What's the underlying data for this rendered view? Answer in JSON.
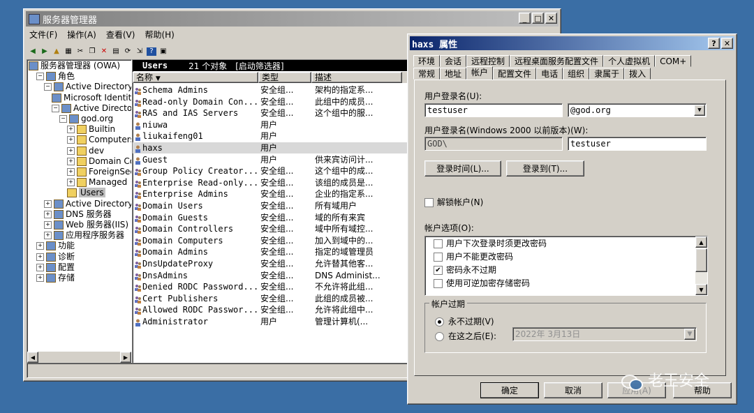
{
  "main": {
    "title": "服务器管理器",
    "menu": [
      "文件(F)",
      "操作(A)",
      "查看(V)",
      "帮助(H)"
    ],
    "tree": [
      {
        "label": "服务器管理器 (OWA)",
        "indent": 0,
        "exp": ""
      },
      {
        "label": "角色",
        "indent": 1,
        "exp": "⊟"
      },
      {
        "label": "Active Directory",
        "indent": 2,
        "exp": "⊟"
      },
      {
        "label": "Microsoft Identity",
        "indent": 3,
        "exp": ""
      },
      {
        "label": "Active Directory",
        "indent": 3,
        "exp": "⊟"
      },
      {
        "label": "god.org",
        "indent": 4,
        "exp": "⊟"
      },
      {
        "label": "Builtin",
        "indent": 5,
        "exp": "⊞"
      },
      {
        "label": "Computers",
        "indent": 5,
        "exp": "⊞"
      },
      {
        "label": "dev",
        "indent": 5,
        "exp": "⊞"
      },
      {
        "label": "Domain Controllers",
        "indent": 5,
        "exp": "⊞"
      },
      {
        "label": "ForeignSecurity",
        "indent": 5,
        "exp": "⊞"
      },
      {
        "label": "Managed",
        "indent": 5,
        "exp": "⊞"
      },
      {
        "label": "Users",
        "indent": 5,
        "exp": "",
        "selected": true
      },
      {
        "label": "Active Directory",
        "indent": 2,
        "exp": "⊞"
      },
      {
        "label": "DNS 服务器",
        "indent": 2,
        "exp": "⊞"
      },
      {
        "label": "Web 服务器(IIS)",
        "indent": 2,
        "exp": "⊞"
      },
      {
        "label": "应用程序服务器",
        "indent": 2,
        "exp": "⊞"
      },
      {
        "label": "功能",
        "indent": 1,
        "exp": "⊞"
      },
      {
        "label": "诊断",
        "indent": 1,
        "exp": "⊞"
      },
      {
        "label": "配置",
        "indent": 1,
        "exp": "⊞"
      },
      {
        "label": "存储",
        "indent": 1,
        "exp": "⊞"
      }
    ],
    "content_header": {
      "title": "Users",
      "count": "21 个对象",
      "filter": "[启动筛选器]"
    },
    "columns": [
      "名称",
      "类型",
      "描述"
    ],
    "rows": [
      {
        "name": "Schema Admins",
        "type": "安全组...",
        "desc": "架构的指定系...",
        "kind": "group"
      },
      {
        "name": "Read-only Domain Con...",
        "type": "安全组...",
        "desc": "此组中的成员...",
        "kind": "group"
      },
      {
        "name": "RAS and IAS Servers",
        "type": "安全组...",
        "desc": "这个组中的服...",
        "kind": "group"
      },
      {
        "name": "niuwa",
        "type": "用户",
        "desc": "",
        "kind": "user"
      },
      {
        "name": "liukaifeng01",
        "type": "用户",
        "desc": "",
        "kind": "user"
      },
      {
        "name": "haxs",
        "type": "用户",
        "desc": "",
        "kind": "user",
        "selected": true
      },
      {
        "name": "Guest",
        "type": "用户",
        "desc": "供来宾访问计...",
        "kind": "user"
      },
      {
        "name": "Group Policy Creator...",
        "type": "安全组...",
        "desc": "这个组中的成...",
        "kind": "group"
      },
      {
        "name": "Enterprise Read-only...",
        "type": "安全组...",
        "desc": "该组的成员是...",
        "kind": "group"
      },
      {
        "name": "Enterprise Admins",
        "type": "安全组...",
        "desc": "企业的指定系...",
        "kind": "group"
      },
      {
        "name": "Domain Users",
        "type": "安全组...",
        "desc": "所有域用户",
        "kind": "group"
      },
      {
        "name": "Domain Guests",
        "type": "安全组...",
        "desc": "域的所有来宾",
        "kind": "group"
      },
      {
        "name": "Domain Controllers",
        "type": "安全组...",
        "desc": "域中所有域控...",
        "kind": "group"
      },
      {
        "name": "Domain Computers",
        "type": "安全组...",
        "desc": "加入到域中的...",
        "kind": "group"
      },
      {
        "name": "Domain Admins",
        "type": "安全组...",
        "desc": "指定的域管理员",
        "kind": "group"
      },
      {
        "name": "DnsUpdateProxy",
        "type": "安全组...",
        "desc": "允许替其他客...",
        "kind": "group"
      },
      {
        "name": "DnsAdmins",
        "type": "安全组...",
        "desc": "DNS Administ...",
        "kind": "group"
      },
      {
        "name": "Denied RODC Password...",
        "type": "安全组...",
        "desc": "不允许将此组...",
        "kind": "group"
      },
      {
        "name": "Cert Publishers",
        "type": "安全组...",
        "desc": "此组的成员被...",
        "kind": "group"
      },
      {
        "name": "Allowed RODC Passwor...",
        "type": "安全组...",
        "desc": "允许将此组中...",
        "kind": "group"
      },
      {
        "name": "Administrator",
        "type": "用户",
        "desc": "管理计算机(...",
        "kind": "user"
      }
    ]
  },
  "dialog": {
    "title": "haxs 属性",
    "tabs_row1": [
      "环境",
      "会话",
      "远程控制",
      "远程桌面服务配置文件",
      "个人虚拟机",
      "COM+"
    ],
    "tabs_row2": [
      "常规",
      "地址",
      "帐户",
      "配置文件",
      "电话",
      "组织",
      "隶属于",
      "拨入"
    ],
    "active_tab": "帐户",
    "logon_name_label": "用户登录名(U):",
    "logon_name_value": "testuser",
    "domain_value": "@god.org",
    "pre2000_label": "用户登录名(Windows 2000 以前版本)(W):",
    "pre2000_domain": "GOD\\",
    "pre2000_user": "testuser",
    "logon_hours_button": "登录时间(L)...",
    "logon_to_button": "登录到(T)...",
    "unlock_label": "解锁帐户(N)",
    "account_options_label": "帐户选项(O):",
    "options": [
      {
        "label": "用户下次登录时须更改密码",
        "checked": false
      },
      {
        "label": "用户不能更改密码",
        "checked": false
      },
      {
        "label": "密码永不过期",
        "checked": true
      },
      {
        "label": "使用可逆加密存储密码",
        "checked": false
      }
    ],
    "expire_group_label": "帐户过期",
    "never_expire_label": "永不过期(V)",
    "end_of_label": "在这之后(E):",
    "expire_date": "2022年  3月13日",
    "ok": "确定",
    "cancel": "取消",
    "apply": "应用(A)",
    "help": "帮助"
  },
  "watermark": "老王安全"
}
